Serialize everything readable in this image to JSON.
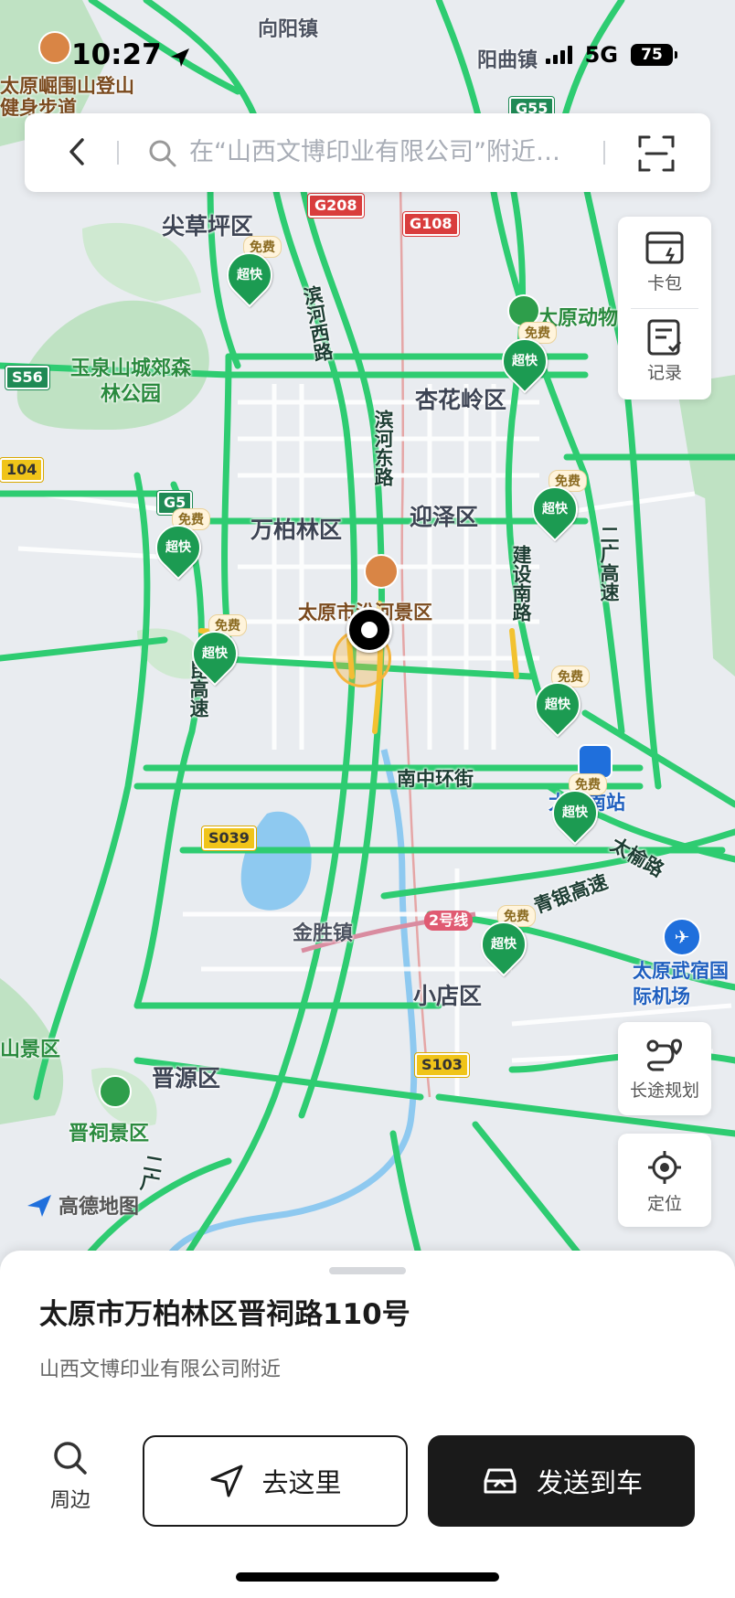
{
  "status_bar": {
    "time": "10:27",
    "network": "5G",
    "battery": "75"
  },
  "search": {
    "placeholder": "在“山西文博印业有限公司”附近搜索"
  },
  "right_panel": {
    "card_pack": "卡包",
    "records": "记录",
    "long_trip": "长途规划",
    "locate": "定位"
  },
  "map": {
    "logo": "高德地图",
    "districts": [
      "尖草坪区",
      "杏花岭区",
      "万柏林区",
      "迎泽区",
      "晋源区",
      "小店区"
    ],
    "towns": [
      "向阳镇",
      "阳曲镇",
      "金胜镇"
    ],
    "roads": [
      "滨河西路",
      "滨河东路",
      "建设南路",
      "二广高速",
      "南中环街",
      "太榆路",
      "青银高速",
      "太古高速",
      "昆高速",
      "二广"
    ],
    "parks": [
      "玉泉山城郊森林公园",
      "晋祠景区",
      "太原动物园",
      "山景区"
    ],
    "pois": [
      "太原市汾河景区",
      "太原崛围山登山健身步道",
      "太原南站"
    ],
    "airport": "太原武宿国际机场",
    "shields": {
      "g208": "G208",
      "g108": "G108",
      "g55": "G55",
      "g5": "G5",
      "s56": "S56",
      "s039": "S039",
      "s103": "S103",
      "m104": "104",
      "metro2": "2号线"
    },
    "charger_tag": "免费",
    "charger_label": "超快"
  },
  "sheet": {
    "address": "太原市万柏林区晋祠路110号",
    "nearby_desc": "山西文博印业有限公司附近",
    "nearby_btn": "周边",
    "go_btn": "去这里",
    "send_btn": "发送到车"
  },
  "colors": {
    "road_green": "#2ecc71",
    "road_yellow": "#f2c230",
    "park_green": "#bfe2c3",
    "water": "#8ec9f0",
    "accent_dark": "#1a1a1a"
  }
}
